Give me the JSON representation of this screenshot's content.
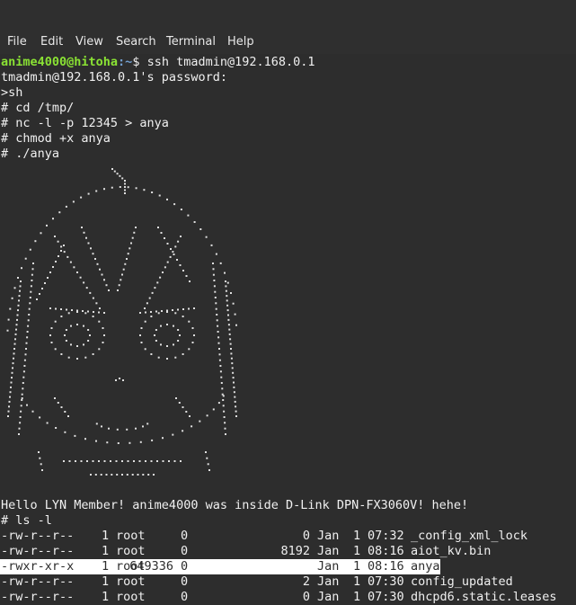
{
  "menubar": {
    "items": [
      "File",
      "Edit",
      "View",
      "Search",
      "Terminal",
      "Help"
    ]
  },
  "terminal": {
    "prompt": {
      "user_host": "anime4000@hitoha",
      "path": ":~",
      "symbol": "$ ",
      "command": "ssh tmadmin@192.168.0.1"
    },
    "lines": [
      "tmadmin@192.168.0.1's password:",
      ">sh",
      "# cd /tmp/",
      "# nc -l -p 12345 > anya",
      "# chmod +x anya",
      "# ./anya"
    ],
    "message": "Hello LYN Member! anime4000 was inside D-Link DPN-FX3060V! hehe!",
    "ls_command": "# ls -l",
    "files": [
      {
        "perms": "-rw-r--r--",
        "links": "1",
        "owner": "root",
        "group": "0",
        "size": "0",
        "month": "Jan",
        "day": "1",
        "time": "07:32",
        "name": "_config_xml_lock"
      },
      {
        "perms": "-rw-r--r--",
        "links": "1",
        "owner": "root",
        "group": "0",
        "size": "8192",
        "month": "Jan",
        "day": "1",
        "time": "08:16",
        "name": "aiot_kv.bin"
      },
      {
        "perms": "-rwxr-xr-x",
        "links": "1",
        "owner": "root",
        "group": "0",
        "size": "649336",
        "month": "Jan",
        "day": "1",
        "time": "08:16",
        "name": "anya"
      },
      {
        "perms": "-rw-r--r--",
        "links": "1",
        "owner": "root",
        "group": "0",
        "size": "2",
        "month": "Jan",
        "day": "1",
        "time": "07:30",
        "name": "config_updated"
      },
      {
        "perms": "-rw-r--r--",
        "links": "1",
        "owner": "root",
        "group": "0",
        "size": "0",
        "month": "Jan",
        "day": "1",
        "time": "07:30",
        "name": "dhcpd6.static.leases"
      }
    ]
  },
  "colors": {
    "background": "#2d2d2d",
    "text": "#f0f0f0",
    "user_host": "#8ae234",
    "path": "#729fcf",
    "selection": "#ffffff"
  },
  "art": {
    "description_icon": "anya-braille-art"
  }
}
